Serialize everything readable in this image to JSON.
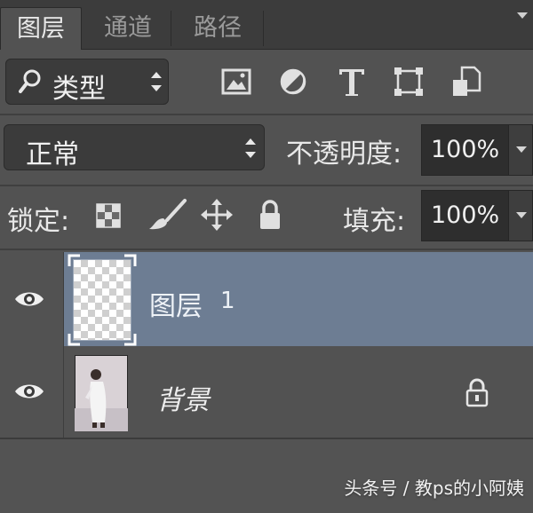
{
  "tabs": [
    {
      "label": "图层",
      "active": true
    },
    {
      "label": "通道",
      "active": false
    },
    {
      "label": "路径",
      "active": false
    }
  ],
  "filter": {
    "kind_label": "类型",
    "icons": [
      "image-filter-icon",
      "adjustment-filter-icon",
      "type-filter-icon",
      "shape-filter-icon",
      "smart-object-filter-icon"
    ]
  },
  "blend": {
    "mode": "正常",
    "opacity_label": "不透明度:",
    "opacity_value": "100%"
  },
  "lock": {
    "label": "锁定:",
    "icons": [
      "lock-transparent-pixels-icon",
      "lock-image-pixels-icon",
      "lock-position-icon",
      "lock-all-icon"
    ],
    "fill_label": "填充:",
    "fill_value": "100%"
  },
  "layers": [
    {
      "name": "图层",
      "number": "1",
      "selected": true,
      "visible": true
    },
    {
      "name": "背景",
      "selected": false,
      "visible": true,
      "locked": true
    }
  ],
  "watermark": "头条号 / 教ps的小阿姨",
  "colors": {
    "panel_bg": "#525252",
    "selected_layer": "#6d7d93",
    "tab_bar": "#3c3c3c"
  }
}
